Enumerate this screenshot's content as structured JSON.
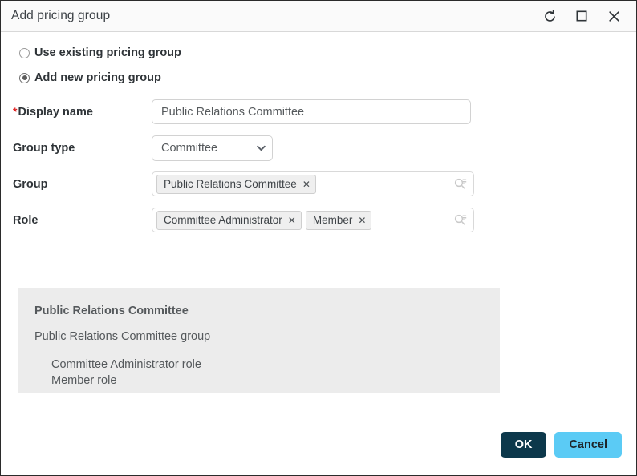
{
  "window": {
    "title": "Add pricing group",
    "controls": [
      {
        "name": "refresh-icon",
        "label": "Refresh"
      },
      {
        "name": "maximize-icon",
        "label": "Maximize"
      },
      {
        "name": "close-icon",
        "label": "Close"
      }
    ]
  },
  "mode_options": [
    {
      "label": "Use existing pricing group",
      "selected": false
    },
    {
      "label": "Add new pricing group",
      "selected": true
    }
  ],
  "fields": {
    "display_name": {
      "label": "Display name",
      "required_marker": "*",
      "value": "Public Relations Committee",
      "placeholder": ""
    },
    "group_type": {
      "label": "Group type",
      "value": "Committee",
      "options": [
        "Committee"
      ]
    },
    "group": {
      "label": "Group",
      "tokens": [
        "Public Relations Committee"
      ],
      "remove_glyph": "✕"
    },
    "role": {
      "label": "Role",
      "tokens": [
        "Committee Administrator",
        "Member"
      ],
      "remove_glyph": "✕"
    }
  },
  "summary": {
    "title": "Public Relations Committee",
    "subtitle": "Public Relations Committee group",
    "roles": [
      "Committee Administrator role",
      "Member role"
    ]
  },
  "footer": {
    "ok_label": "OK",
    "cancel_label": "Cancel"
  },
  "colors": {
    "ok_button": "#0c384b",
    "cancel_button": "#5bcbf5",
    "required_star": "#e02020",
    "summary_background": "#ececec"
  }
}
